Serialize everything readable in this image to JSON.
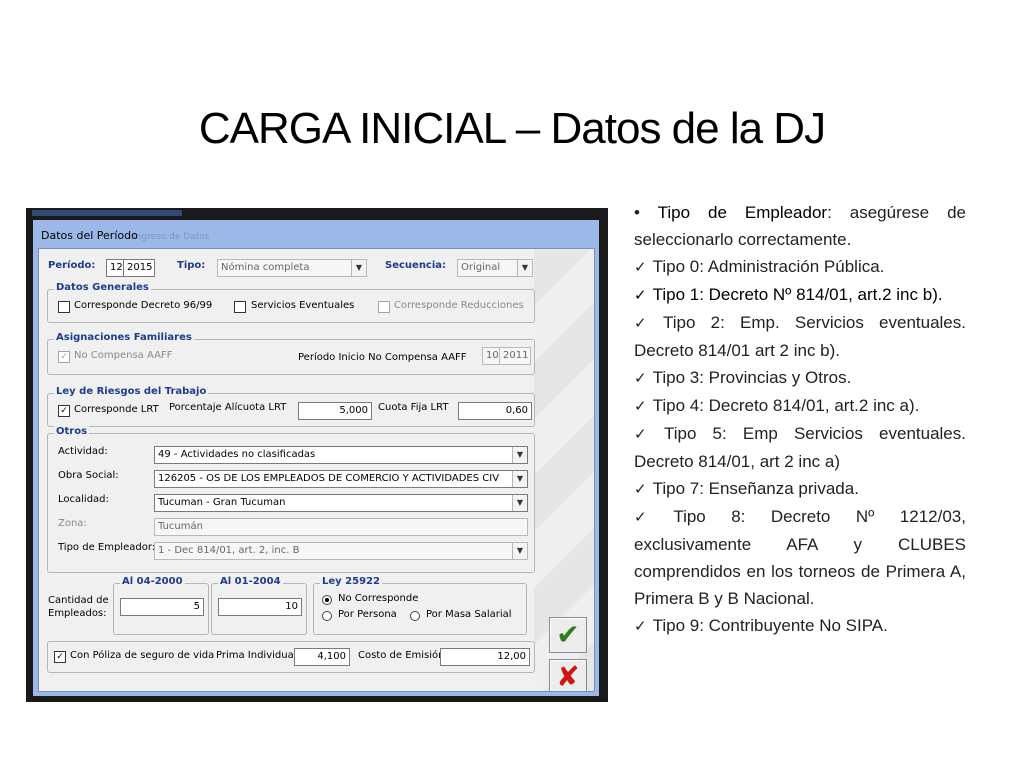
{
  "slide_title": "CARGA INICIAL – Datos de la DJ",
  "window": {
    "ghost_text": "Ingreso de Datos",
    "title": "Datos del Período",
    "periodo_label": "Período:",
    "periodo_month": "12",
    "periodo_year": "2015",
    "tipo_label": "Tipo:",
    "tipo_value": "Nómina completa",
    "secuencia_label": "Secuencia:",
    "secuencia_value": "Original",
    "datos_generales": {
      "caption": "Datos Generales",
      "decreto_label": "Corresponde Decreto 96/99",
      "eventuales_label": "Servicios Eventuales",
      "reducciones_label": "Corresponde Reducciones"
    },
    "asignaciones": {
      "caption": "Asignaciones Familiares",
      "no_compensa_label": "No Compensa AAFF",
      "inicio_label": "Período Inicio No Compensa AAFF",
      "inicio_month": "10",
      "inicio_year": "2011"
    },
    "lrt": {
      "caption": "Ley de Riesgos del Trabajo",
      "corresponde_label": "Corresponde LRT",
      "alicuota_label": "Porcentaje Alícuota  LRT",
      "alicuota_value": "5,000",
      "cuota_label": "Cuota Fija LRT",
      "cuota_value": "0,60"
    },
    "otros": {
      "caption": "Otros",
      "actividad_label": "Actividad:",
      "actividad_value": "49 - Actividades no clasificadas",
      "obra_label": "Obra Social:",
      "obra_value": "126205 - OS  DE LOS EMPLEADOS DE COMERCIO Y ACTIVIDADES CIV",
      "localidad_label": "Localidad:",
      "localidad_value": "Tucuman - Gran Tucuman",
      "zona_label": "Zona:",
      "zona_value": "Tucumán",
      "tipo_emp_label": "Tipo de Empleador:",
      "tipo_emp_value": "1 - Dec 814/01, art. 2, inc. B"
    },
    "empleados": {
      "cantidad_label_1": "Cantidad de",
      "cantidad_label_2": "Empleados:",
      "al_2000_caption": "Al 04-2000",
      "al_2000_value": "5",
      "al_2004_caption": "Al 01-2004",
      "al_2004_value": "10"
    },
    "ley25922": {
      "caption": "Ley 25922",
      "opt_no": "No Corresponde",
      "opt_persona": "Por Persona",
      "opt_masa": "Por Masa Salarial"
    },
    "seguro": {
      "poliza_label": "Con Póliza de seguro de vida",
      "prima_label": "Prima Individual:",
      "prima_value": "4,100",
      "costo_label": "Costo de Emisión:",
      "costo_value": "12,00"
    },
    "ok_glyph": "✔",
    "cancel_glyph": "✘"
  },
  "notes": {
    "intro_bullet": "•",
    "intro_bold": "Tipo de Empleador",
    "intro_rest": ": asegúrese de seleccionarlo correctamente.",
    "tick": "✓",
    "items": [
      "Tipo 0: Administración Pública.",
      "Tipo 1: Decreto Nº 814/01, art.2 inc b).",
      "Tipo 2: Emp. Servicios eventuales. Decreto 814/01 art 2 inc b).",
      "Tipo 3: Provincias y Otros.",
      "Tipo 4: Decreto 814/01, art.2 inc a).",
      "Tipo 5: Emp Servicios eventuales. Decreto 814/01, art 2 inc a)",
      "Tipo 7: Enseñanza privada.",
      "Tipo 8: Decreto Nº 1212/03, exclusivamente AFA y CLUBES comprendidos en los torneos de Primera A, Primera B y B Nacional.",
      "Tipo 9: Contribuyente No SIPA."
    ]
  }
}
